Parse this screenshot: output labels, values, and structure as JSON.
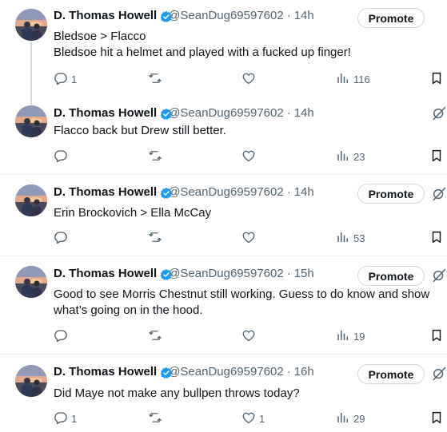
{
  "tweets": [
    {
      "name": "D. Thomas Howell",
      "handle": "@SeanDug69597602",
      "time": "14h",
      "promote": "Promote",
      "lines": [
        "Bledsoe > Flacco",
        "Bledsoe hit a helmet and played with a fucked up finger!"
      ],
      "replies": "1",
      "retweets": "",
      "likes": "",
      "views": "116"
    },
    {
      "name": "D. Thomas Howell",
      "handle": "@SeanDug69597602",
      "time": "14h",
      "promote": "",
      "lines": [
        "Flacco back but Drew still better."
      ],
      "replies": "",
      "retweets": "",
      "likes": "",
      "views": "23"
    },
    {
      "name": "D. Thomas Howell",
      "handle": "@SeanDug69597602",
      "time": "14h",
      "promote": "Promote",
      "lines": [
        "Erin Brockovich > Ella McCay"
      ],
      "replies": "",
      "retweets": "",
      "likes": "",
      "views": "53"
    },
    {
      "name": "D. Thomas Howell",
      "handle": "@SeanDug69597602",
      "time": "15h",
      "promote": "Promote",
      "lines": [
        "Good to see Morris Chestnut still working. Guess to do know and show",
        "what’s going on in the hood."
      ],
      "replies": "",
      "retweets": "",
      "likes": "",
      "views": "19"
    },
    {
      "name": "D. Thomas Howell",
      "handle": "@SeanDug69597602",
      "time": "16h",
      "promote": "Promote",
      "lines": [
        "Did Maye not make any bullpen throws today?"
      ],
      "replies": "1",
      "retweets": "",
      "likes": "1",
      "views": "29"
    }
  ],
  "icons": {
    "reply": "reply-icon",
    "retweet": "retweet-icon",
    "like": "like-icon",
    "views": "views-icon",
    "bookmark": "bookmark-icon",
    "grok": "grok-icon",
    "badge": "verified-badge-icon"
  },
  "colors": {
    "text": "#0f1419",
    "secondary": "#536471",
    "border": "#eff3f4",
    "thread_line": "#cfd9de",
    "badge": "#1d9bf0"
  }
}
